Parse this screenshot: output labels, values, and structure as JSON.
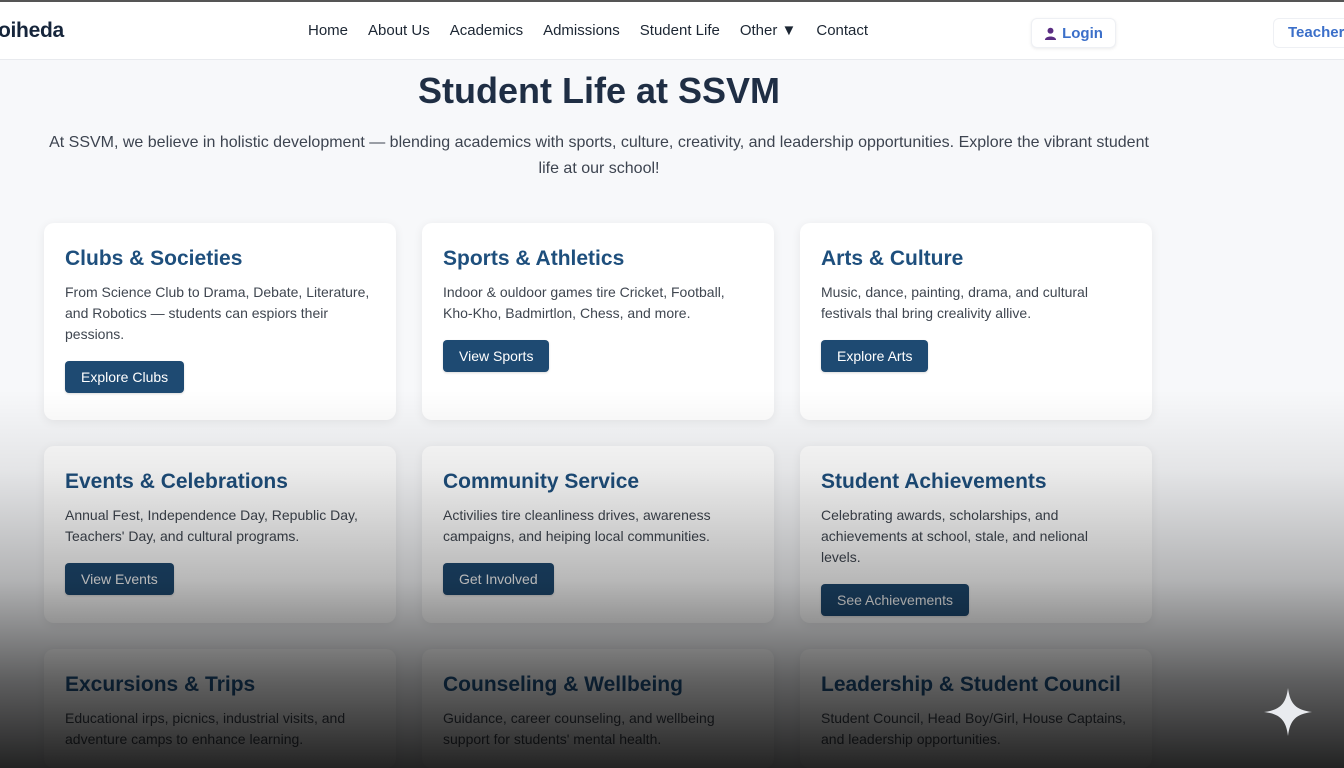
{
  "header": {
    "brand": "oiheda",
    "nav": [
      "Home",
      "About Us",
      "Academics",
      "Admissions",
      "Student Life",
      "Other ▼",
      "Contact"
    ],
    "login_label": "Login",
    "teacher_label": "Teacher"
  },
  "main": {
    "title": "Student Life at SSVM",
    "intro": "At SSVM, we believe in holistic development — blending academics with sports, culture, creativity, and leadership opportunities. Explore the vibrant student life at our school!",
    "cards": [
      {
        "title": "Clubs & Societies",
        "text": "From Science Club to Drama, Debate, Literature, and Robotics — students can espiors their pessions.",
        "button": "Explore Clubs"
      },
      {
        "title": "Sports & Athletics",
        "text": "Indoor & ouldoor games tire Cricket, Football, Kho-Kho, Badmirtlon, Chess, and more.",
        "button": "View Sports"
      },
      {
        "title": "Arts & Culture",
        "text": "Music, dance, painting, drama, and cultural festivals thal bring crealivity allive.",
        "button": "Explore Arts"
      },
      {
        "title": "Events & Celebrations",
        "text": "Annual Fest, Independence Day, Republic Day, Teachers' Day, and cultural programs.",
        "button": "View Events"
      },
      {
        "title": "Community Service",
        "text": "Activilies tire cleanliness drives, awareness campaigns, and heiping local communities.",
        "button": "Get Involved"
      },
      {
        "title": "Student Achievements",
        "text": "Celebrating awards, scholarships, and achievements at school, stale, and nelional levels.",
        "button": "See Achievements"
      },
      {
        "title": "Excursions & Trips",
        "text": "Educational irps, picnics, industrial visits, and adventure camps to enhance learning.",
        "button": ""
      },
      {
        "title": "Counseling & Wellbeing",
        "text": "Guidance, career counseling, and wellbeing support for students' mental health.",
        "button": ""
      },
      {
        "title": "Leadership & Student Council",
        "text": "Student Council, Head Boy/Girl, House Captains, and leadership opportunities.",
        "button": ""
      }
    ]
  },
  "icons": {
    "login": "user-icon",
    "corner": "sparkle-icon"
  },
  "colors": {
    "accent": "#1e4a72",
    "heading": "#1e4f7d",
    "link": "#3b6fc9"
  }
}
